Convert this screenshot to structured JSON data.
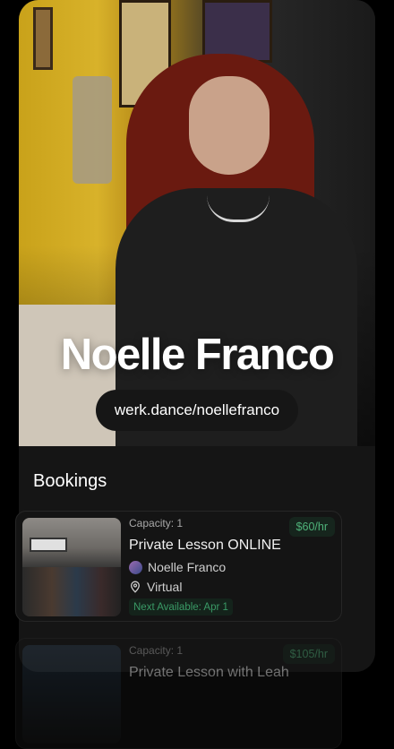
{
  "profile": {
    "name": "Noelle Franco",
    "url": "werk.dance/noellefranco"
  },
  "bookings": {
    "title": "Bookings",
    "items": [
      {
        "capacity": "Capacity: 1",
        "price": "$60/hr",
        "title": "Private Lesson ONLINE",
        "instructor": "Noelle Franco",
        "location": "Virtual",
        "next_available": "Next Available: Apr 1"
      },
      {
        "capacity": "Capacity: 1",
        "price": "$105/hr",
        "title": "Private Lesson with Leah"
      }
    ]
  },
  "colors": {
    "price_text": "#4fb37a",
    "price_bg": "#16251d",
    "next_text": "#3a9a66"
  }
}
